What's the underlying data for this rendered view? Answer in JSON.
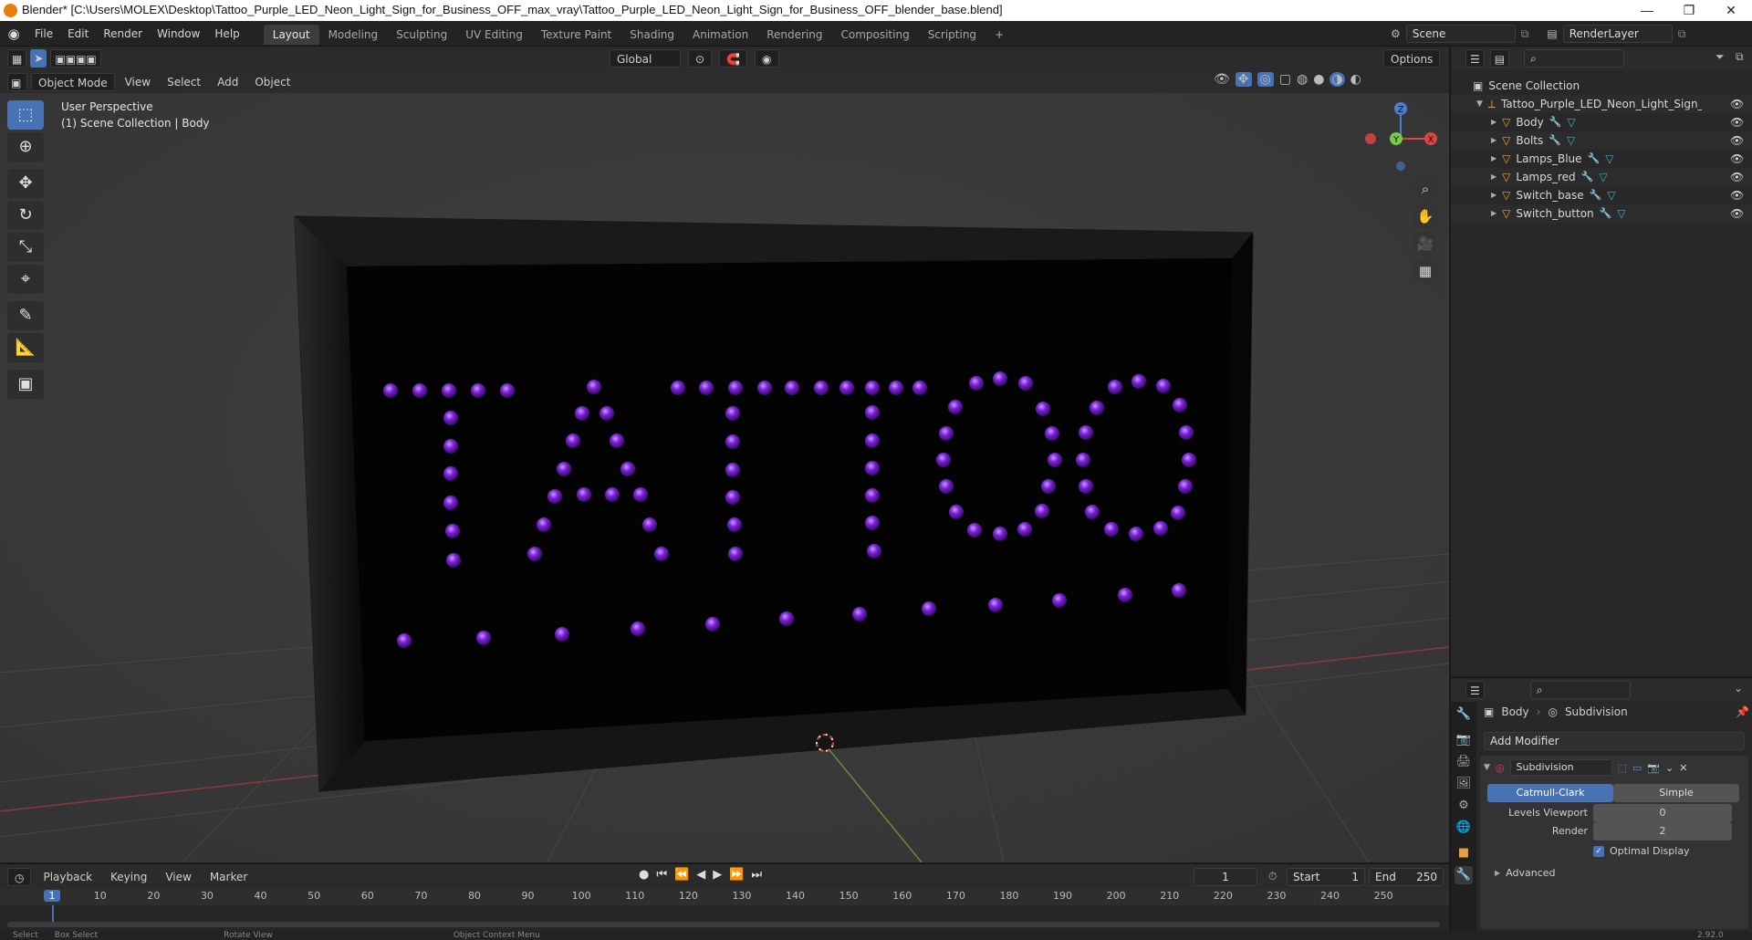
{
  "window": {
    "title": "Blender* [C:\\Users\\MOLEX\\Desktop\\Tattoo_Purple_LED_Neon_Light_Sign_for_Business_OFF_max_vray\\Tattoo_Purple_LED_Neon_Light_Sign_for_Business_OFF_blender_base.blend]",
    "minimize": "—",
    "maximize": "❐",
    "close": "✕"
  },
  "menu": [
    "File",
    "Edit",
    "Render",
    "Window",
    "Help"
  ],
  "workspaces": [
    "Layout",
    "Modeling",
    "Sculpting",
    "UV Editing",
    "Texture Paint",
    "Shading",
    "Animation",
    "Rendering",
    "Compositing",
    "Scripting"
  ],
  "workspace_add": "+",
  "scene": {
    "label": "Scene",
    "render_layer": "RenderLayer"
  },
  "viewport": {
    "mode": "Object Mode",
    "menus": [
      "View",
      "Select",
      "Add",
      "Object"
    ],
    "orientation": "Global",
    "options": "Options",
    "info_line1": "User Perspective",
    "info_line2": "(1) Scene Collection | Body",
    "gizmo": {
      "z": "Z",
      "y": "Y",
      "x": "X"
    },
    "sign_text": "TATTOO"
  },
  "timeline": {
    "menus": [
      "Playback",
      "Keying",
      "View",
      "Marker"
    ],
    "current_frame": "1",
    "start_label": "Start",
    "start": "1",
    "end_label": "End",
    "end": "250",
    "ticks": [
      "1",
      "10",
      "20",
      "30",
      "40",
      "50",
      "60",
      "70",
      "80",
      "90",
      "100",
      "110",
      "120",
      "130",
      "140",
      "150",
      "160",
      "170",
      "180",
      "190",
      "200",
      "210",
      "220",
      "230",
      "240",
      "250"
    ]
  },
  "statusbar": {
    "select": "Select",
    "box_select": "Box Select",
    "rotate": "Rotate View",
    "context": "Object Context Menu",
    "version": "2.92.0"
  },
  "outliner": {
    "root": "Scene Collection",
    "collection": "Tattoo_Purple_LED_Neon_Light_Sign_for_Bus",
    "items": [
      "Body",
      "Bolts",
      "Lamps_Blue",
      "Lamps_red",
      "Switch_base",
      "Switch_button"
    ]
  },
  "properties": {
    "object": "Body",
    "modifier_context": "Subdivision",
    "add_modifier": "Add Modifier",
    "modifier_name": "Subdivision",
    "catmull": "Catmull-Clark",
    "simple": "Simple",
    "levels_viewport_label": "Levels Viewport",
    "levels_viewport": "0",
    "render_label": "Render",
    "render": "2",
    "optimal_display": "Optimal Display",
    "advanced": "Advanced"
  },
  "colors": {
    "accent": "#4772b3",
    "led": "#7a22d6",
    "blender_orange": "#e87d0d"
  }
}
